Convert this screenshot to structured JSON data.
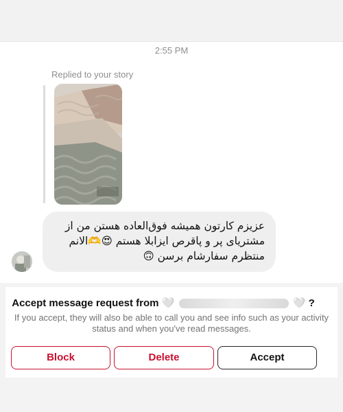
{
  "conversation": {
    "timestamp": "2:55 PM",
    "replied_label": "Replied to your story",
    "message_lines": [
      "عزیزم کارتون همیشه فوق‌العاده هستن من از",
      "مشتریای پر و پاقرص ایزابلا هستم 😍🫶الانم",
      "منتظرم سفارشام برسن 🙃"
    ]
  },
  "request": {
    "title_prefix": "Accept message request from",
    "title_heart_left": "🤍",
    "title_name": "s... (...)",
    "title_heart_right": "🤍",
    "title_suffix": "?",
    "description": "If you accept, they will also be able to call you and see info such as your activity status and when you've read messages.",
    "block_label": "Block",
    "delete_label": "Delete",
    "accept_label": "Accept"
  },
  "colors": {
    "danger": "#c8102e",
    "bubble": "#efefef",
    "muted_text": "#8e8e8e"
  }
}
